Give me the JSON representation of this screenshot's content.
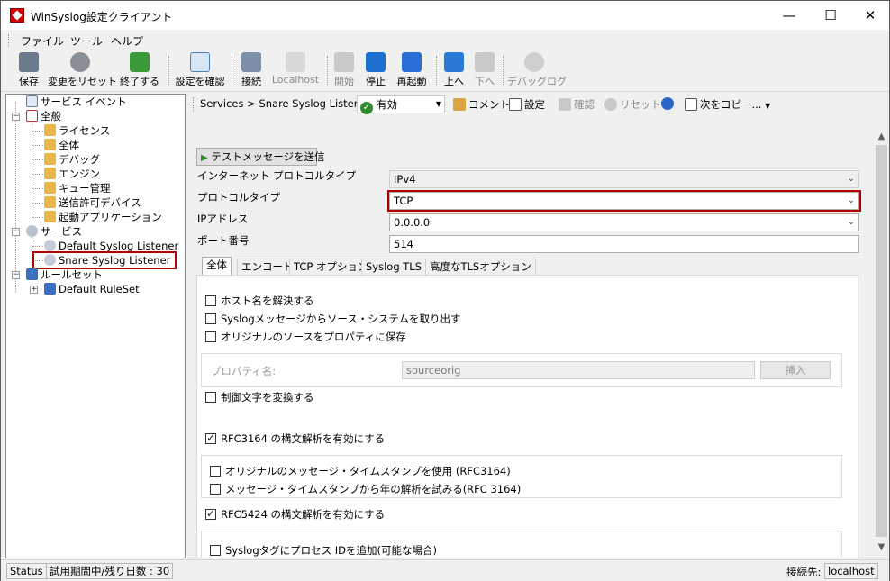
{
  "window": {
    "title": "WinSyslog設定クライアント",
    "minimize": "—",
    "maximize": "☐",
    "close": "✕"
  },
  "menu": {
    "file": "ファイル",
    "tools": "ツール",
    "help": "ヘルプ"
  },
  "toolbar": {
    "save": "保存",
    "reset": "変更をリセット",
    "exit": "終了する",
    "check_config": "設定を確認",
    "connect": "接続",
    "localhost": "Localhost",
    "start": "開始",
    "stop": "停止",
    "restart": "再起動",
    "up": "上へ",
    "down": "下へ",
    "debug_log": "デバッグログ"
  },
  "tree": {
    "service_events": "サービス イベント",
    "general": "全般",
    "license": "ライセンス",
    "overall": "全体",
    "debug": "デバッグ",
    "engine": "エンジン",
    "queue_management": "キュー管理",
    "allowed_senders": "送信許可デバイス",
    "startup_apps": "起動アプリケーション",
    "services": "サービス",
    "default_syslog_listener": "Default Syslog Listener",
    "snare_syslog_listener": "Snare Syslog Listener",
    "rulesets": "ルールセット",
    "default_ruleset": "Default RuleSet"
  },
  "header": {
    "breadcrumb": "Services > Snare Syslog Listener",
    "status_value": "有効",
    "comment": "コメント",
    "settings": "設定",
    "confirm": "確認",
    "reset": "リセット",
    "copy_next": "次をコピー..."
  },
  "form": {
    "send_test_button": "テストメッセージを送信",
    "protocol_type_label": "インターネット プロトコルタイプ",
    "protocol_type_value": "IPv4",
    "transport_label": "プロトコルタイプ",
    "transport_value": "TCP",
    "ip_label": "IPアドレス",
    "ip_value": "0.0.0.0",
    "port_label": "ポート番号",
    "port_value": "514"
  },
  "tabs": [
    "全体",
    "エンコード",
    "TCP オプション",
    "Syslog TLS",
    "高度なTLSオプション"
  ],
  "general_tab": {
    "resolve_hostname": {
      "label": "ホスト名を解決する",
      "checked": false
    },
    "extract_source": {
      "label": "Syslogメッセージからソース・システムを取り出す",
      "checked": false
    },
    "keep_original_source": {
      "label": "オリジナルのソースをプロパティに保存",
      "checked": false
    },
    "property_name_label": "プロパティ名:",
    "property_name_value": "sourceorig",
    "insert_button": "挿入",
    "convert_control_chars": {
      "label": "制御文字を変換する",
      "checked": false
    },
    "rfc3164_parsing": {
      "label": "RFC3164 の構文解析を有効にする",
      "checked": true
    },
    "use_original_timestamp": {
      "label": "オリジナルのメッセージ・タイムスタンプを使用 (RFC3164)",
      "checked": false
    },
    "parse_year": {
      "label": "メッセージ・タイムスタンプから年の解析を試みる(RFC 3164)",
      "checked": false
    },
    "rfc5424_parsing": {
      "label": "RFC5424 の構文解析を有効にする",
      "checked": true
    },
    "append_process_id": {
      "label": "Syslogタグにプロセス IDを追加(可能な場合)",
      "checked": false
    }
  },
  "statusbar": {
    "status_label": "Status",
    "trial_text": "試用期間中/残り日数 : 30",
    "connected_label": "接続先:",
    "connected_host": "localhost"
  }
}
